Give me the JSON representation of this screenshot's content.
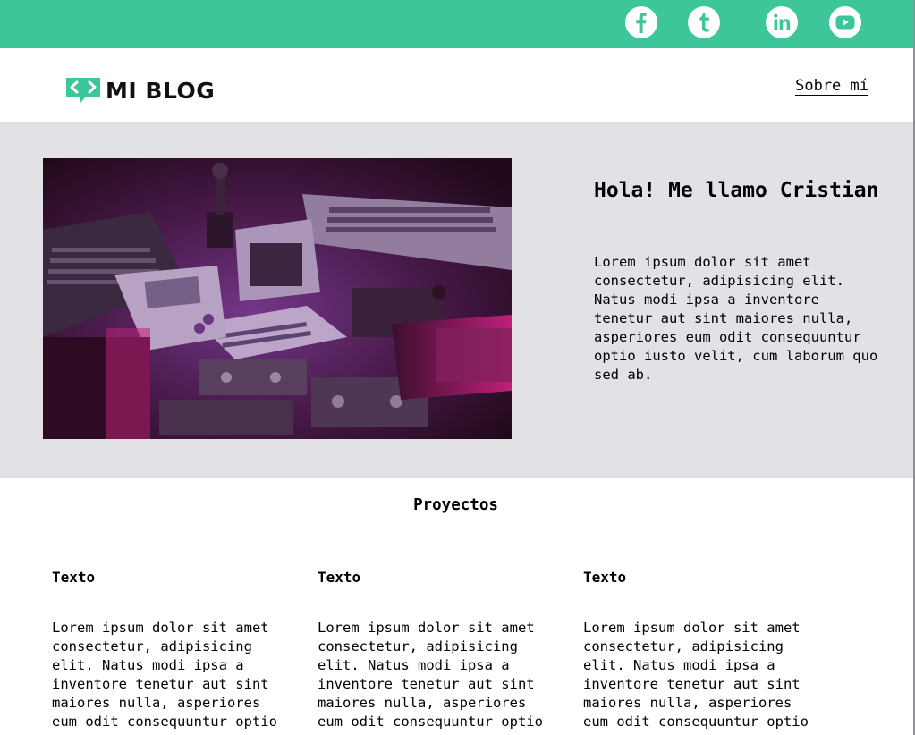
{
  "social": {
    "icons": [
      "facebook-icon",
      "tumblr-icon",
      "linkedin-icon",
      "youtube-icon"
    ],
    "bar_color": "#3ec69b",
    "icon_color": "#ffffff"
  },
  "header": {
    "logo_text": "MI BLOG",
    "nav_link": "Sobre mí"
  },
  "hero": {
    "title": "Hola! Me llamo Cristian",
    "text": "Lorem ipsum dolor sit amet consectetur, adipisicing elit. Natus modi ipsa a inventore tenetur aut sint maiores nulla, asperiores eum odit consequuntur optio iusto velit, cum laborum quo sed ab.",
    "background_color": "#e1e1e6"
  },
  "projects": {
    "heading": "Proyectos",
    "items": [
      {
        "title": "Texto",
        "text": "Lorem ipsum dolor sit amet consectetur, adipisicing elit. Natus modi ipsa a inventore tenetur aut sint maiores nulla, asperiores eum odit consequuntur optio"
      },
      {
        "title": "Texto",
        "text": "Lorem ipsum dolor sit amet consectetur, adipisicing elit. Natus modi ipsa a inventore tenetur aut sint maiores nulla, asperiores eum odit consequuntur optio"
      },
      {
        "title": "Texto",
        "text": "Lorem ipsum dolor sit amet consectetur, adipisicing elit. Natus modi ipsa a inventore tenetur aut sint maiores nulla, asperiores eum odit consequuntur optio"
      }
    ]
  }
}
